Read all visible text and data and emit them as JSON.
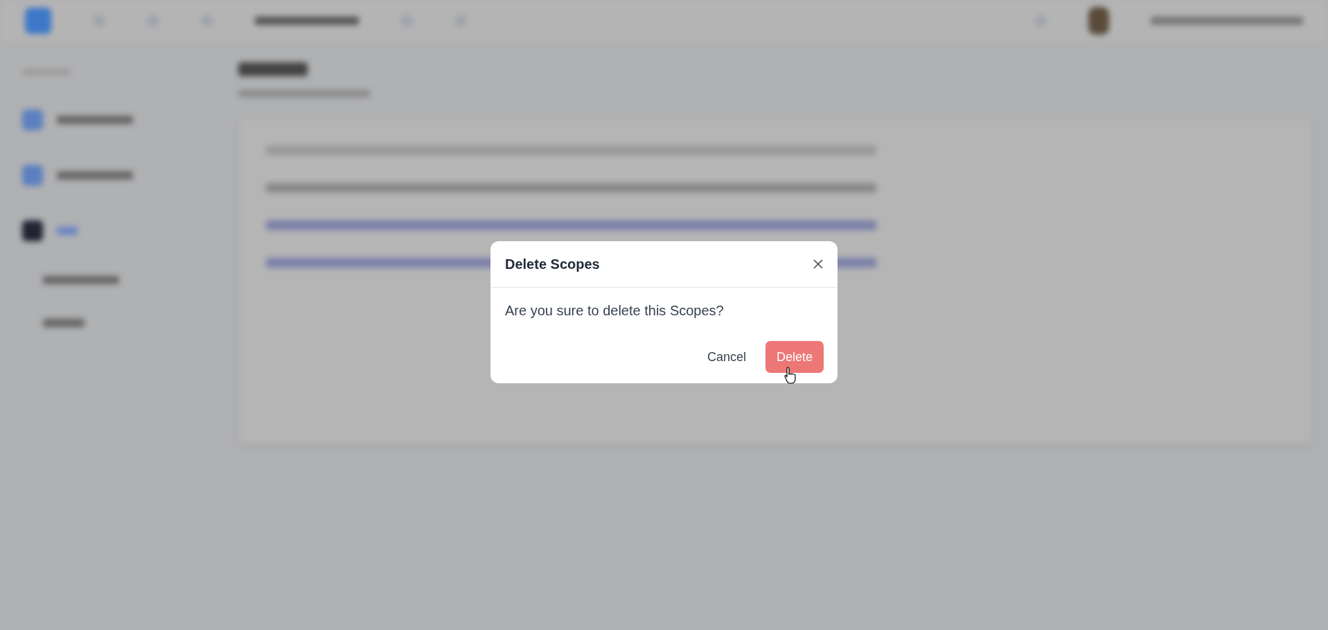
{
  "dialog": {
    "title": "Delete Scopes",
    "message": "Are you sure to delete this Scopes?",
    "buttons": [
      {
        "label": "Cancel",
        "kind": "text"
      },
      {
        "label": "Delete",
        "kind": "danger"
      }
    ]
  }
}
